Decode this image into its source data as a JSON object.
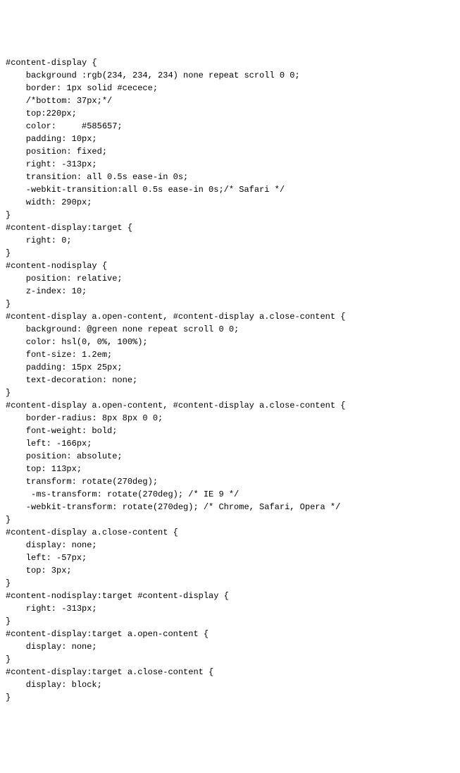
{
  "code_lines": [
    "#content-display {",
    "    background :rgb(234, 234, 234) none repeat scroll 0 0;",
    "    border: 1px solid #cecece;",
    "    /*bottom: 37px;*/",
    "    top:220px;",
    "    color:     #585657;",
    "    padding: 10px;",
    "    position: fixed;",
    "    right: -313px;",
    "    transition: all 0.5s ease-in 0s;",
    "    -webkit-transition:all 0.5s ease-in 0s;/* Safari */",
    "    width: 290px;",
    "}",
    "#content-display:target {",
    "    right: 0;",
    "}",
    "#content-nodisplay {",
    "    position: relative;",
    "    z-index: 10;",
    "}",
    "#content-display a.open-content, #content-display a.close-content {",
    "    background: @green none repeat scroll 0 0;",
    "    color: hsl(0, 0%, 100%);",
    "    font-size: 1.2em;",
    "    padding: 15px 25px;",
    "    text-decoration: none;",
    "}",
    "#content-display a.open-content, #content-display a.close-content {",
    "    border-radius: 8px 8px 0 0;",
    "    font-weight: bold;",
    "    left: -166px;",
    "    position: absolute;",
    "    top: 113px;",
    "    transform: rotate(270deg);",
    "     -ms-transform: rotate(270deg); /* IE 9 */",
    "    -webkit-transform: rotate(270deg); /* Chrome, Safari, Opera */",
    "}",
    "#content-display a.close-content {",
    "    display: none;",
    "    left: -57px;",
    "    top: 3px;",
    "}",
    "#content-nodisplay:target #content-display {",
    "    right: -313px;",
    "}",
    "#content-display:target a.open-content {",
    "    display: none;",
    "}",
    "#content-display:target a.close-content {",
    "    display: block;",
    "}"
  ]
}
